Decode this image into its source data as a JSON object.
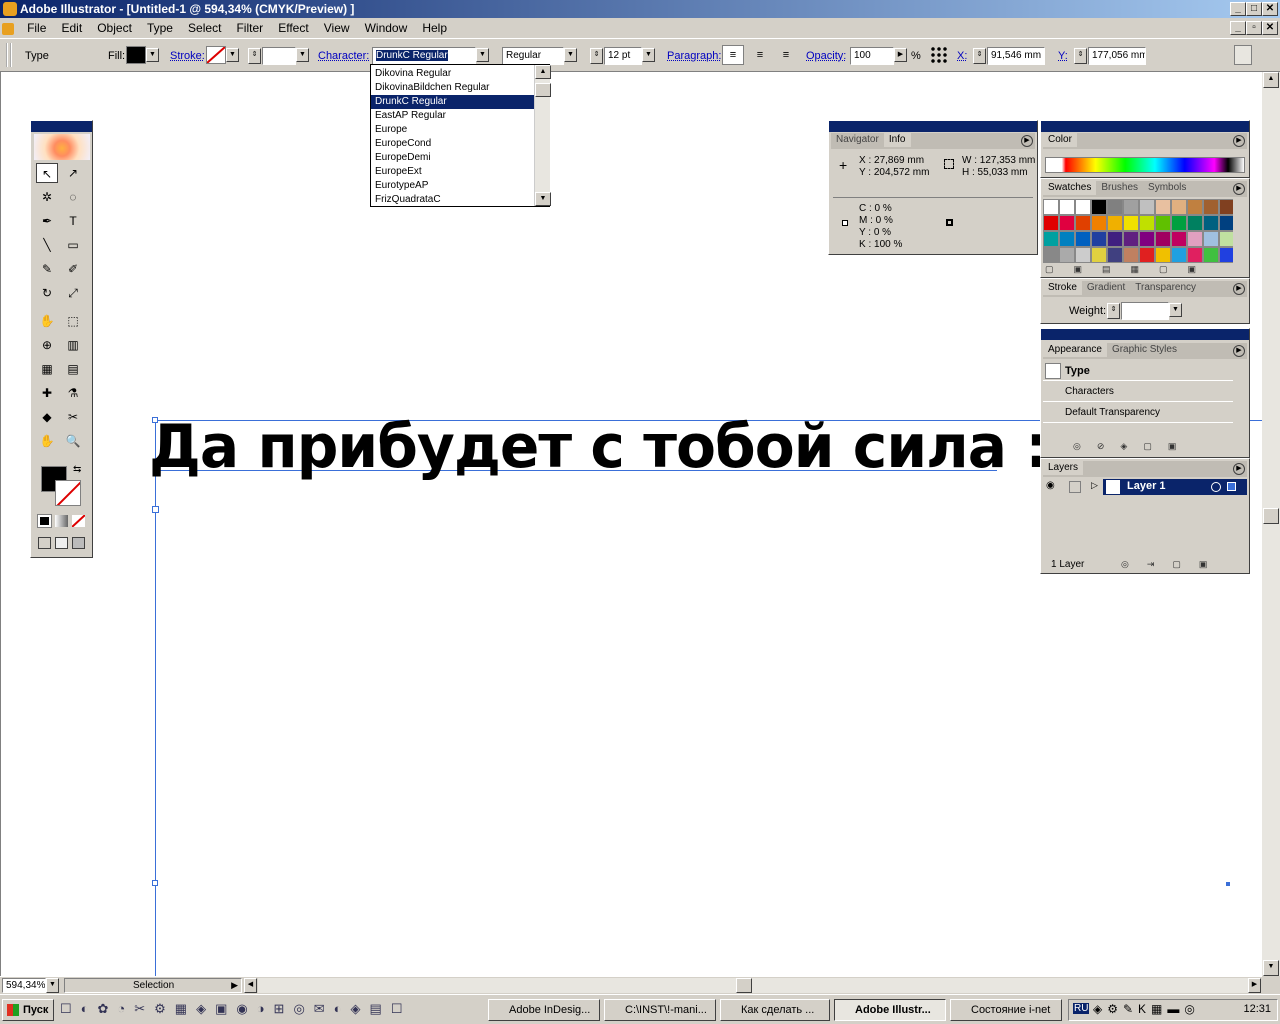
{
  "window": {
    "title": "Adobe Illustrator - [Untitled-1 @ 594,34% (CMYK/Preview) ]"
  },
  "menu": [
    "File",
    "Edit",
    "Object",
    "Type",
    "Select",
    "Filter",
    "Effect",
    "View",
    "Window",
    "Help"
  ],
  "control": {
    "mode": "Type",
    "fill_label": "Fill:",
    "stroke_label": "Stroke:",
    "character_label": "Character:",
    "font_value": "DrunkC Regular",
    "style_value": "Regular",
    "size_value": "12 pt",
    "paragraph_label": "Paragraph:",
    "opacity_label": "Opacity:",
    "opacity_value": "100",
    "percent": "%",
    "x_label": "X:",
    "x_value": "91,546 mm",
    "y_label": "Y:",
    "y_value": "177,056 mm"
  },
  "font_list": {
    "items": [
      "Dikovina Regular",
      "DikovinaBildchen Regular",
      "DrunkC Regular",
      "EastAP Regular",
      "Europe",
      "EuropeCond",
      "EuropeDemi",
      "EuropeExt",
      "EurotypeAP",
      "FrizQuadrataC"
    ],
    "selected_index": 2
  },
  "canvas": {
    "text": "Да прибудет с тобой сила :)"
  },
  "navigator": {
    "tabs": [
      "Navigator",
      "Info"
    ],
    "x": "X  : 27,869 mm",
    "y": "Y  : 204,572 mm",
    "w": "W  : 127,353 mm",
    "h": "H  : 55,033 mm",
    "c": "C  : 0 %",
    "m": "M  : 0 %",
    "yv": "Y  : 0 %",
    "k": "K  : 100 %"
  },
  "color_panel": {
    "tab": "Color"
  },
  "swatches_panel": {
    "tabs": [
      "Swatches",
      "Brushes",
      "Symbols"
    ]
  },
  "stroke_panel": {
    "tabs": [
      "Stroke",
      "Gradient",
      "Transparency"
    ],
    "weight_label": "Weight:"
  },
  "appearance_panel": {
    "tabs": [
      "Appearance",
      "Graphic Styles"
    ],
    "items": [
      "Type",
      "Characters",
      "Default Transparency"
    ]
  },
  "layers_panel": {
    "tab": "Layers",
    "layer": "Layer 1",
    "footer": "1 Layer"
  },
  "status": {
    "zoom": "594,34%",
    "tool": "Selection"
  },
  "taskbar": {
    "start": "Пуск",
    "tasks": [
      "Adobe InDesig...",
      "C:\\INST\\!-mani...",
      "Как сделать ...",
      "Adobe Illustr...",
      "Состояние i-net"
    ],
    "clock": "12:31",
    "lang": "RU"
  },
  "colors": {
    "accent": "#0a246a",
    "selection_blue": "#3a6fd8"
  }
}
